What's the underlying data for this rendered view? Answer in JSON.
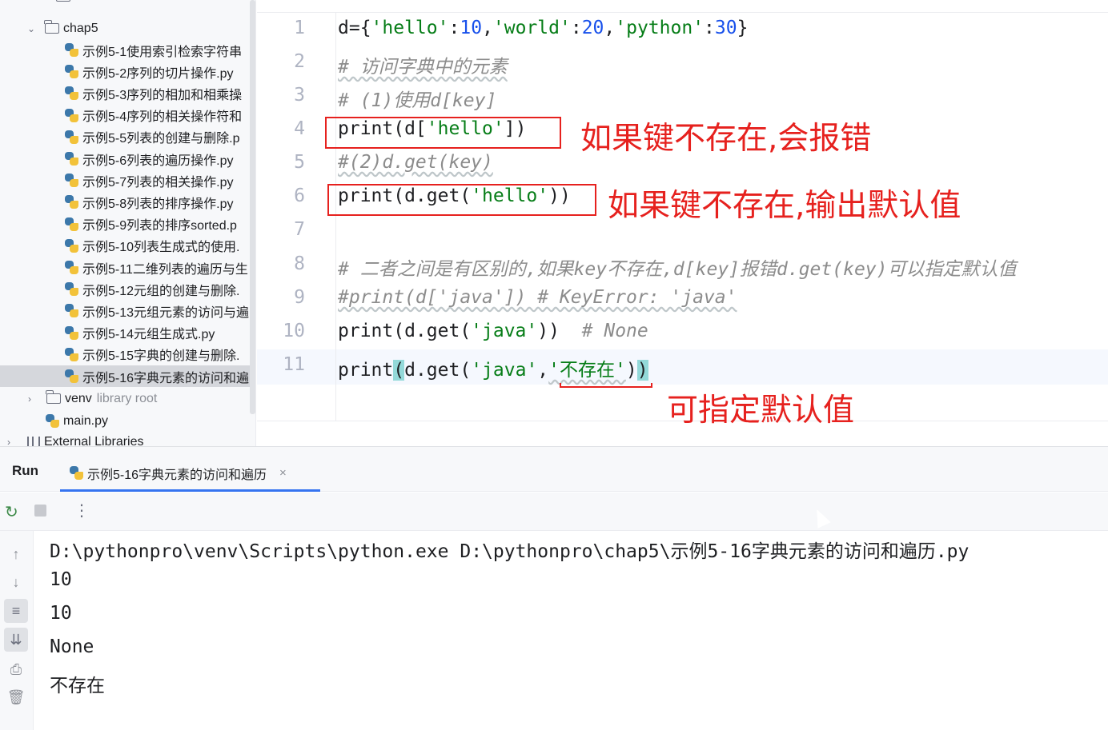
{
  "project_tree": {
    "chap5_folder": "chap5",
    "files": [
      "示例5-1使用索引检索字符串",
      "示例5-2序列的切片操作.py",
      "示例5-3序列的相加和相乘操",
      "示例5-4序列的相关操作符和",
      "示例5-5列表的创建与删除.p",
      "示例5-6列表的遍历操作.py",
      "示例5-7列表的相关操作.py",
      "示例5-8列表的排序操作.py",
      "示例5-9列表的排序sorted.p",
      "示例5-10列表生成式的使用.",
      "示例5-11二维列表的遍历与生",
      "示例5-12元组的创建与删除.",
      "示例5-13元组元素的访问与遍",
      "示例5-14元组生成式.py",
      "示例5-15字典的创建与删除.",
      "示例5-16字典元素的访问和遍"
    ],
    "venv_label": "venv",
    "venv_note": "library root",
    "main_file": "main.py",
    "external_libraries": "External Libraries"
  },
  "editor": {
    "line_numbers": [
      "1",
      "2",
      "3",
      "4",
      "5",
      "6",
      "7",
      "8",
      "9",
      "10",
      "11"
    ],
    "lines": [
      {
        "parts": [
          [
            "d={",
            ""
          ],
          [
            "'hello'",
            "str"
          ],
          [
            ":",
            ""
          ],
          [
            "10",
            "num"
          ],
          [
            ",",
            ""
          ],
          [
            "'world'",
            "str"
          ],
          [
            ":",
            ""
          ],
          [
            "20",
            "num"
          ],
          [
            ",",
            ""
          ],
          [
            "'python'",
            "str"
          ],
          [
            ":",
            ""
          ],
          [
            "30",
            "num"
          ],
          [
            "}",
            ""
          ]
        ]
      },
      {
        "parts": [
          [
            "# 访问字典中的元素",
            "cmt"
          ]
        ]
      },
      {
        "parts": [
          [
            "# (1)使用d[key]",
            "cmt"
          ]
        ]
      },
      {
        "parts": [
          [
            "print(d[",
            ""
          ],
          [
            "'hello'",
            "str"
          ],
          [
            "])",
            ""
          ]
        ]
      },
      {
        "parts": [
          [
            "#(2)d.get(key)",
            "cmt"
          ]
        ]
      },
      {
        "parts": [
          [
            "print(d.get(",
            ""
          ],
          [
            "'hello'",
            "str"
          ],
          [
            "))",
            ""
          ]
        ]
      },
      {
        "parts": []
      },
      {
        "parts": [
          [
            "# 二者之间是有区别的,如果key不存在,d[key]报错d.get(key)可以指定默认值",
            "cmt"
          ]
        ]
      },
      {
        "parts": [
          [
            "#print(d['java']) # KeyError: 'java'",
            "cmt"
          ]
        ]
      },
      {
        "parts": [
          [
            "print(d.get(",
            ""
          ],
          [
            "'java'",
            "str"
          ],
          [
            "))  ",
            ""
          ],
          [
            "# None",
            "cmt"
          ]
        ]
      },
      {
        "parts": [
          [
            "print",
            ""
          ],
          [
            "(",
            "bm"
          ],
          [
            "d.get(",
            ""
          ],
          [
            "'java'",
            "str"
          ],
          [
            ",",
            ""
          ],
          [
            "'不存在'",
            "str"
          ],
          [
            ")",
            ""
          ],
          [
            ")",
            "bm"
          ]
        ]
      }
    ]
  },
  "annotations": {
    "note_line4": "如果键不存在,会报错",
    "note_line6": "如果键不存在,输出默认值",
    "note_line11": "可指定默认值",
    "color": "#e6211e"
  },
  "run_panel": {
    "title": "Run",
    "tab_label": "示例5-16字典元素的访问和遍历",
    "tab_close": "×",
    "output": [
      "D:\\pythonpro\\venv\\Scripts\\python.exe D:\\pythonpro\\chap5\\示例5-16字典元素的访问和遍历.py",
      "10",
      "10",
      "None",
      "不存在"
    ]
  },
  "icons": {
    "rerun": "rerun-icon",
    "stop": "stop-icon",
    "more": "more-options-icon",
    "up": "arrow-up-icon",
    "down": "arrow-down-icon",
    "wrap": "soft-wrap-icon",
    "scroll_end": "scroll-to-end-icon",
    "print": "print-icon",
    "trash": "trash-icon"
  }
}
